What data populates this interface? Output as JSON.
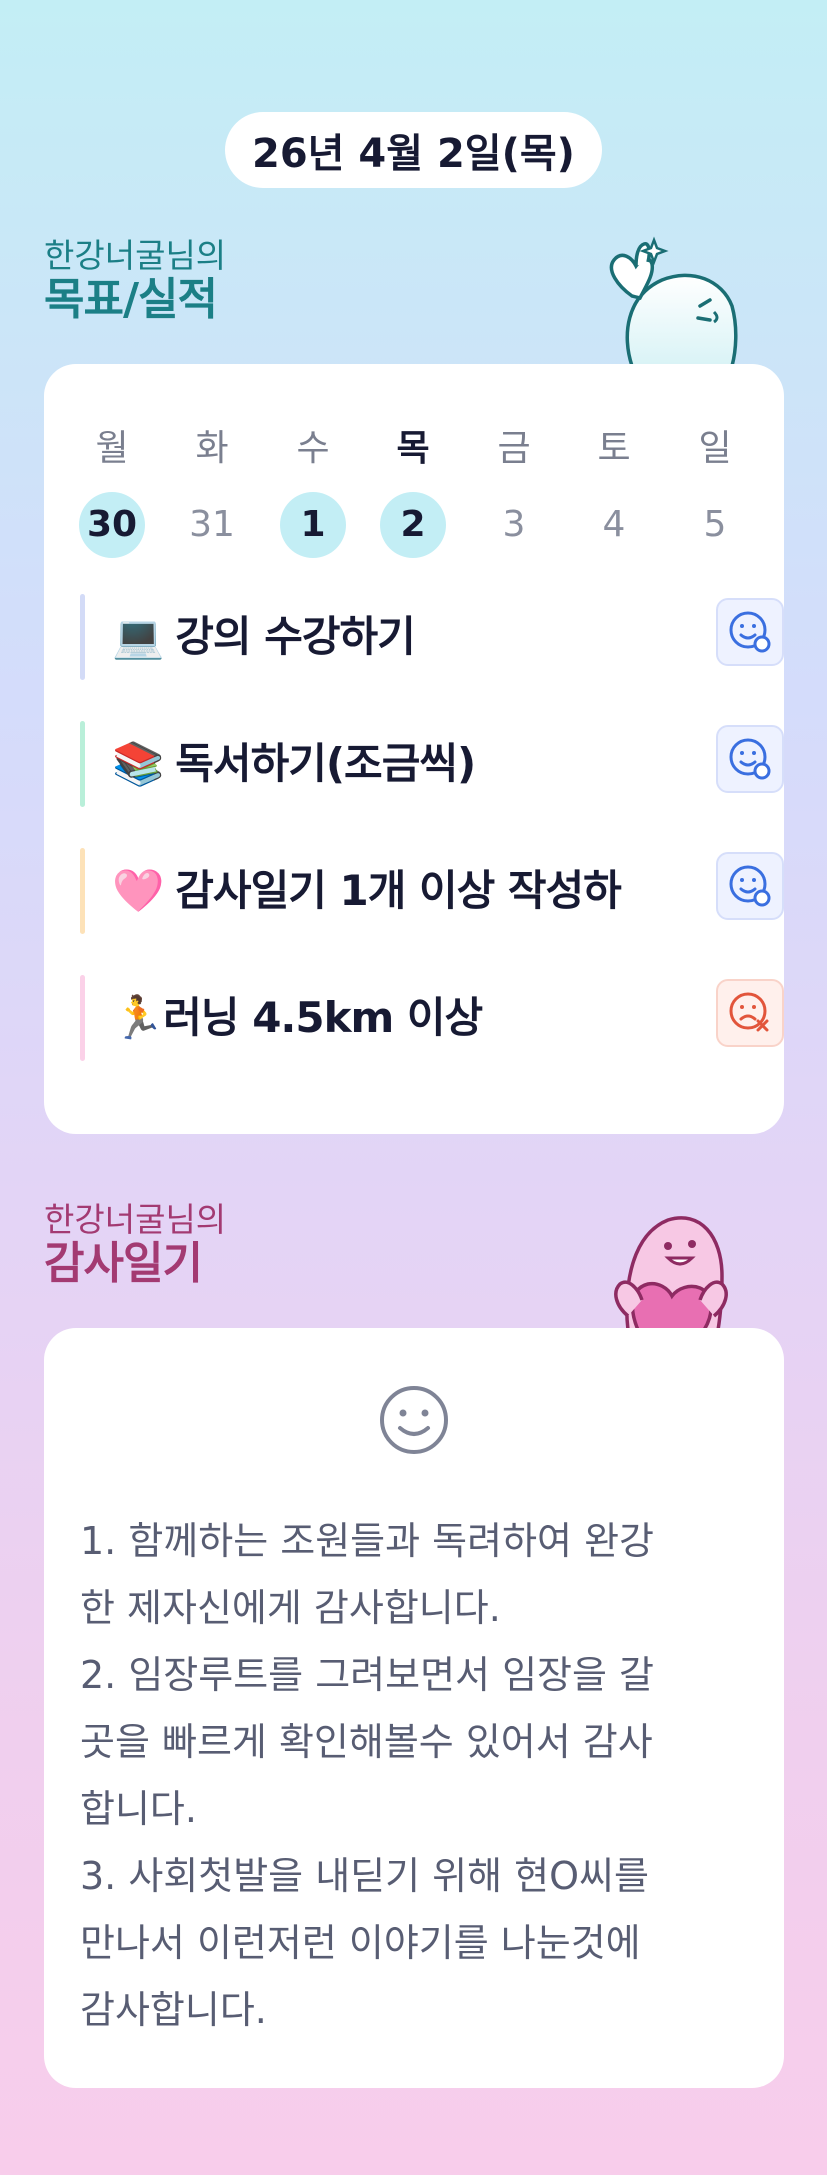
{
  "header": {
    "date": "26년 4월 2일(목)"
  },
  "goals_section": {
    "owner": "한강너굴님의",
    "title": "목표/실적"
  },
  "week": [
    {
      "name": "월",
      "date": "30",
      "highlight": true,
      "today": false
    },
    {
      "name": "화",
      "date": "31",
      "highlight": false,
      "today": false
    },
    {
      "name": "수",
      "date": "1",
      "highlight": true,
      "today": false
    },
    {
      "name": "목",
      "date": "2",
      "highlight": true,
      "today": true
    },
    {
      "name": "금",
      "date": "3",
      "highlight": false,
      "today": false
    },
    {
      "name": "토",
      "date": "4",
      "highlight": false,
      "today": false
    },
    {
      "name": "일",
      "date": "5",
      "highlight": false,
      "today": false
    }
  ],
  "goals": [
    {
      "emoji": "💻",
      "label": "강의 수강하기",
      "bar_color": "#d3dbf7",
      "status": "done"
    },
    {
      "emoji": "📚",
      "label": "독서하기(조금씩)",
      "bar_color": "#b9efd9",
      "status": "done"
    },
    {
      "emoji": "🩷",
      "label": "감사일기 1개 이상 작성하",
      "bar_color": "#fde2b8",
      "status": "done"
    },
    {
      "emoji": "🏃",
      "label": "러닝 4.5km 이상",
      "bar_color": "#fbd1e8",
      "status": "failed"
    }
  ],
  "gratitude_section": {
    "owner": "한강너굴님의",
    "title": "감사일기"
  },
  "gratitude": {
    "mood_icon": "smile-icon",
    "text": "1. 함께하는 조원들과 독려하여 완강\n한 제자신에게 감사합니다.\n2. 임장루트를 그려보면서 임장을 갈\n곳을 빠르게 확인해볼수 있어서 감사\n합니다.\n3. 사회첫발을 내딛기 위해 현O씨를\n만나서 이런저런 이야기를 나눈것에\n감사합니다."
  },
  "colors": {
    "done_icon": "#3a6fe0",
    "failed_icon": "#e2553b",
    "goals_title": "#1b7f86",
    "gratitude_title": "#a33a72"
  }
}
